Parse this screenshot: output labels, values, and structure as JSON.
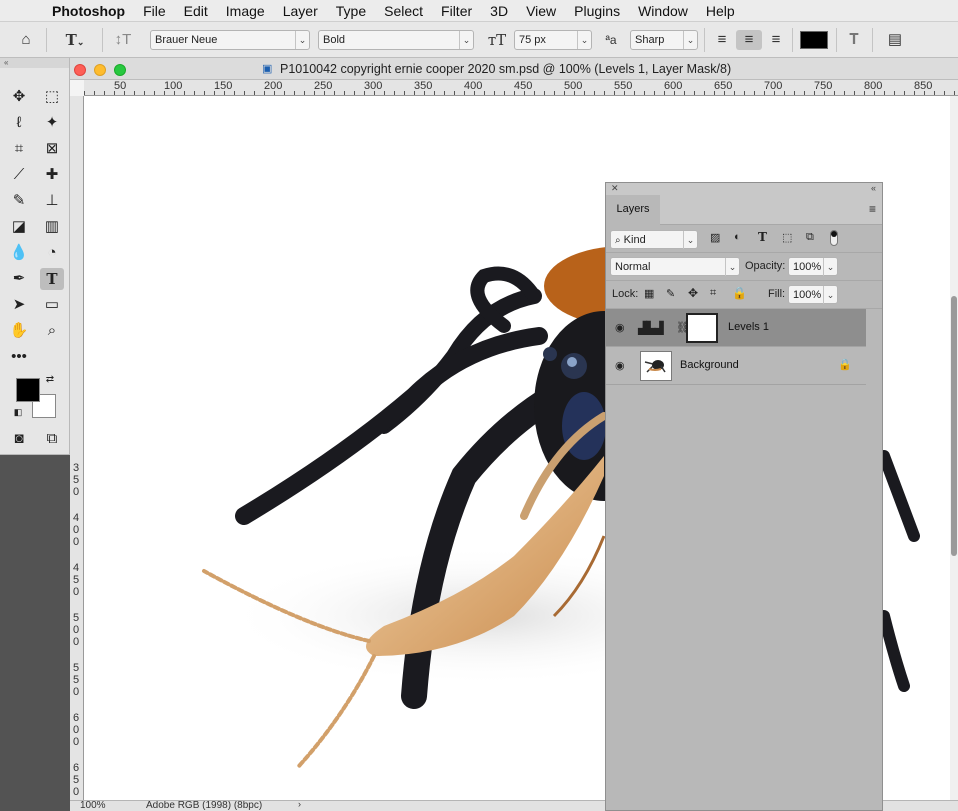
{
  "menubar": {
    "app": "Photoshop",
    "items": [
      "File",
      "Edit",
      "Image",
      "Layer",
      "Type",
      "Select",
      "Filter",
      "3D",
      "View",
      "Plugins",
      "Window",
      "Help"
    ]
  },
  "options": {
    "font_family": "Brauer Neue",
    "font_style": "Bold",
    "font_size": "75 px",
    "aa_label": "ªa",
    "anti_alias": "Sharp",
    "text_color": "#000000"
  },
  "document": {
    "title": "P1010042 copyright ernie cooper 2020 sm.psd @ 100% (Levels 1, Layer Mask/8)",
    "ruler_h": [
      "50",
      "100",
      "150",
      "200",
      "250",
      "300",
      "350",
      "400",
      "450",
      "500",
      "550",
      "600",
      "650",
      "700",
      "750",
      "800",
      "850"
    ],
    "ruler_v": [
      "3",
      "5",
      "0",
      "4",
      "0",
      "0",
      "4",
      "5",
      "0",
      "5",
      "0",
      "0",
      "5",
      "5",
      "0",
      "6",
      "0",
      "0",
      "6",
      "5",
      "0"
    ],
    "status_zoom": "100%",
    "status_profile": "Adobe RGB (1998) (8bpc)"
  },
  "layers_panel": {
    "tab": "Layers",
    "filter_kind": "Kind",
    "blend_mode": "Normal",
    "opacity_label": "Opacity:",
    "opacity": "100%",
    "lock_label": "Lock:",
    "fill_label": "Fill:",
    "fill": "100%",
    "layers": [
      {
        "name": "Levels 1"
      },
      {
        "name": "Background"
      }
    ]
  },
  "colors": {
    "foreground": "#000000",
    "background": "#ffffff",
    "accent": "#8e8e8e"
  }
}
